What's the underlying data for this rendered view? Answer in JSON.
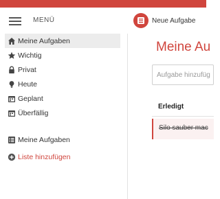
{
  "header": {
    "menu_label": "MENÜ",
    "new_task_label": "Neue Aufgabe",
    "accent_color": "#d0453d"
  },
  "sidebar": {
    "items": [
      {
        "label": "Meine Aufgaben",
        "icon": "home-icon",
        "active": true
      },
      {
        "label": "Wichtig",
        "icon": "star-icon"
      },
      {
        "label": "Privat",
        "icon": "lock-icon"
      },
      {
        "label": "Heute",
        "icon": "lightbulb-icon"
      },
      {
        "label": "Geplant",
        "icon": "calendar-icon"
      },
      {
        "label": "Überfällig",
        "icon": "calendar-icon"
      }
    ],
    "lists": [
      {
        "label": "Meine Aufgaben",
        "icon": "list-icon"
      }
    ],
    "add_list_label": "Liste hinzufügen"
  },
  "main": {
    "title": "Meine Au",
    "input_placeholder": "Aufgabe hinzufüg",
    "done_header": "Erledigt",
    "done_tasks": [
      {
        "text": "Silo sauber mac"
      }
    ]
  }
}
